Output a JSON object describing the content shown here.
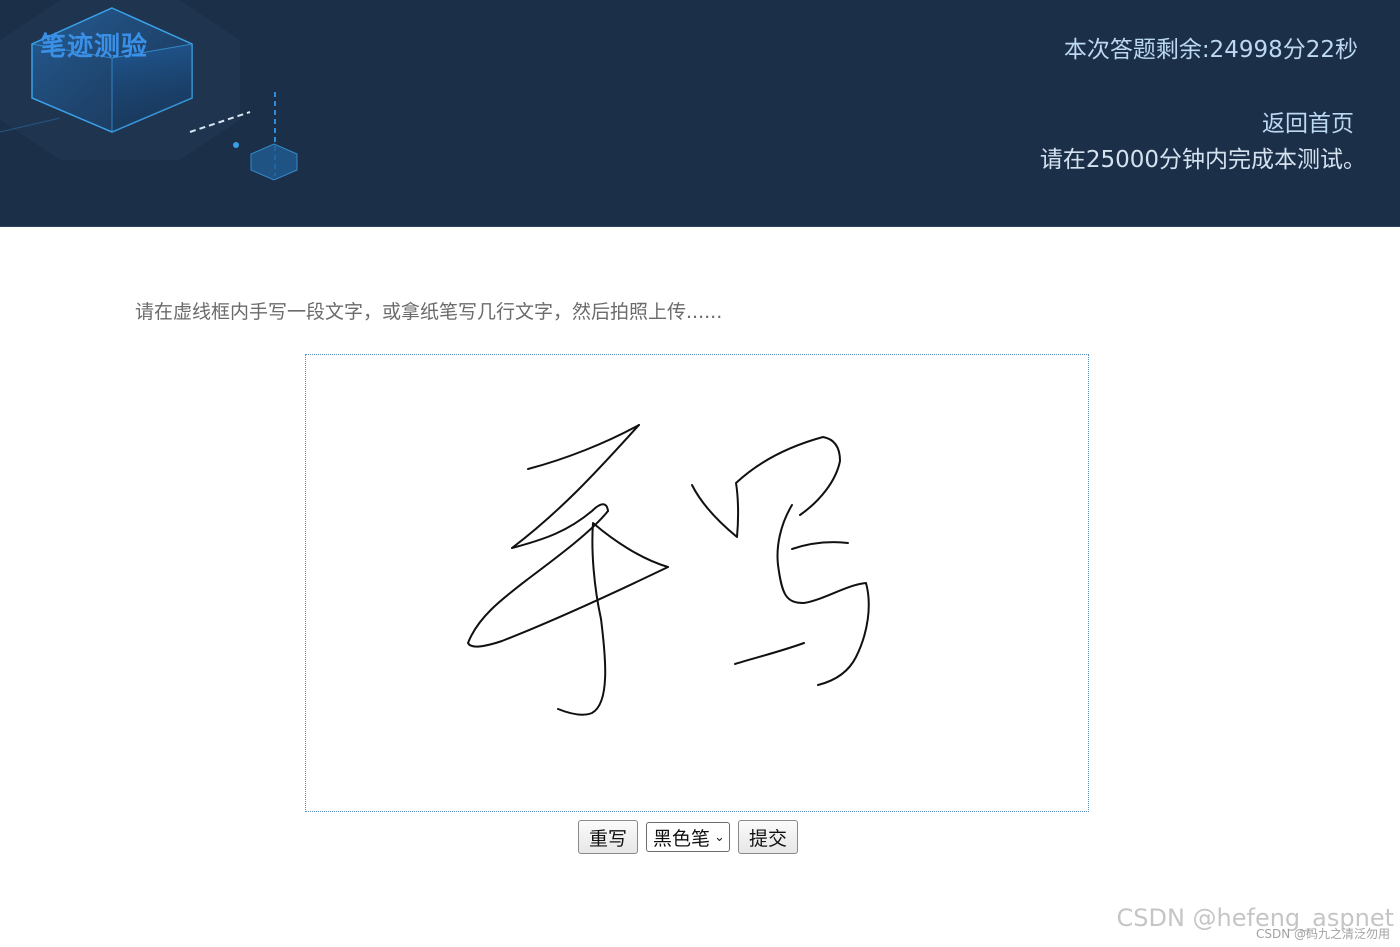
{
  "header": {
    "title": "笔迹测验",
    "timer_text": "本次答题剩余:24998分22秒",
    "home_link": "返回首页",
    "time_limit_text": "请在25000分钟内完成本测试。"
  },
  "main": {
    "instruction": "请在虚线框内手写一段文字，或拿纸笔写几行文字，然后拍照上传......",
    "controls": {
      "rewrite_label": "重写",
      "pen_select_value": "黑色笔",
      "submit_label": "提交"
    }
  },
  "watermark": {
    "text": "CSDN @hefeng_aspnet",
    "small_text": "CSDN @码九之清泛勿用"
  },
  "colors": {
    "header_bg": "#1c2f48",
    "title_blue": "#3a8fe6",
    "header_text": "#bcd8f2",
    "ink": "#111111"
  },
  "icons": {
    "select_arrow": "chevron-down-icon",
    "header_art": "hexagon-cube-decoration"
  }
}
